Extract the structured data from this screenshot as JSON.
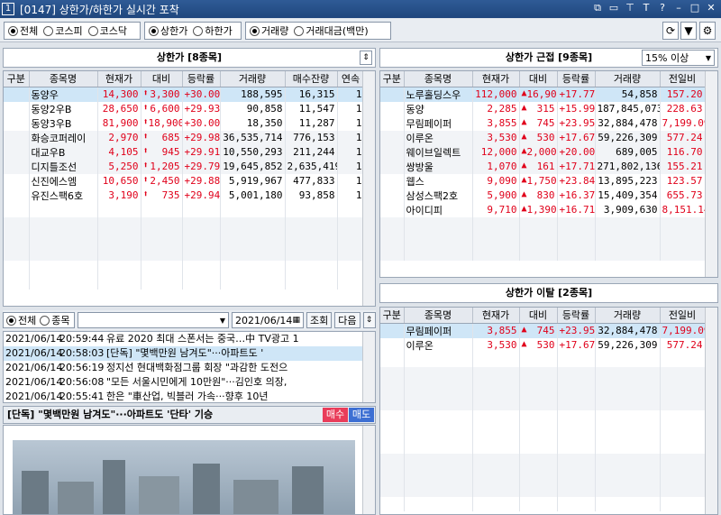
{
  "window": {
    "number": "1",
    "title": "[0147] 상한가/하한가 실시간 포착"
  },
  "filters": {
    "market": [
      "전체",
      "코스피",
      "코스닥"
    ],
    "limit_type": [
      "상한가",
      "하한가"
    ],
    "sort_by": [
      "거래량",
      "거래대금(백만)"
    ]
  },
  "upper": {
    "title": "상한가 [8종목]",
    "columns": [
      "구분",
      "종목명",
      "현재가",
      "대비",
      "등락률",
      "거래량",
      "매수잔량",
      "연속"
    ],
    "rows": [
      {
        "name": "동양우",
        "price": "14,300",
        "diff": "3,300",
        "rate": "+30.00",
        "vol": "188,595",
        "bid": "16,315",
        "cont": "1"
      },
      {
        "name": "동양2우B",
        "price": "28,650",
        "diff": "6,600",
        "rate": "+29.93",
        "vol": "90,858",
        "bid": "11,547",
        "cont": "1"
      },
      {
        "name": "동양3우B",
        "price": "81,900",
        "diff": "18,900",
        "rate": "+30.00",
        "vol": "18,350",
        "bid": "11,287",
        "cont": "1"
      },
      {
        "name": "화승코퍼레이",
        "price": "2,970",
        "diff": "685",
        "rate": "+29.98",
        "vol": "36,535,714",
        "bid": "776,153",
        "cont": "1"
      },
      {
        "name": "대교우B",
        "price": "4,105",
        "diff": "945",
        "rate": "+29.91",
        "vol": "10,550,293",
        "bid": "211,244",
        "cont": "1"
      },
      {
        "name": "디지틀조선",
        "price": "5,250",
        "diff": "1,205",
        "rate": "+29.79",
        "vol": "19,645,852",
        "bid": "2,635,419",
        "cont": "1"
      },
      {
        "name": "신진에스엠",
        "price": "10,650",
        "diff": "2,450",
        "rate": "+29.88",
        "vol": "5,919,967",
        "bid": "477,833",
        "cont": "1"
      },
      {
        "name": "유진스팩6호",
        "price": "3,190",
        "diff": "735",
        "rate": "+29.94",
        "vol": "5,001,180",
        "bid": "93,858",
        "cont": "1"
      }
    ]
  },
  "near": {
    "title": "상한가 근접 [9종목]",
    "threshold": "15% 이상",
    "columns": [
      "구분",
      "종목명",
      "현재가",
      "대비",
      "등락률",
      "거래량",
      "전일비"
    ],
    "rows": [
      {
        "name": "노루홀딩스우",
        "price": "112,000",
        "diff": "16,900",
        "rate": "+17.77",
        "vol": "54,858",
        "prev": "157.20"
      },
      {
        "name": "동양",
        "price": "2,285",
        "diff": "315",
        "rate": "+15.99",
        "vol": "187,845,073",
        "prev": "228.63"
      },
      {
        "name": "무림페이퍼",
        "price": "3,855",
        "diff": "745",
        "rate": "+23.95",
        "vol": "32,884,478",
        "prev": "7,199.09"
      },
      {
        "name": "이루온",
        "price": "3,530",
        "diff": "530",
        "rate": "+17.67",
        "vol": "59,226,309",
        "prev": "577.24"
      },
      {
        "name": "웨이브일렉트",
        "price": "12,000",
        "diff": "2,000",
        "rate": "+20.00",
        "vol": "689,005",
        "prev": "116.70"
      },
      {
        "name": "쌍방울",
        "price": "1,070",
        "diff": "161",
        "rate": "+17.71",
        "vol": "271,802,136",
        "prev": "155.21"
      },
      {
        "name": "웹스",
        "price": "9,090",
        "diff": "1,750",
        "rate": "+23.84",
        "vol": "13,895,223",
        "prev": "123.57"
      },
      {
        "name": "삼성스팩2호",
        "price": "5,900",
        "diff": "830",
        "rate": "+16.37",
        "vol": "15,409,354",
        "prev": "655.73"
      },
      {
        "name": "아이디피",
        "price": "9,710",
        "diff": "1,390",
        "rate": "+16.71",
        "vol": "3,909,630",
        "prev": "8,151.14"
      }
    ]
  },
  "leave": {
    "title": "상한가 이탈 [2종목]",
    "columns": [
      "구분",
      "종목명",
      "현재가",
      "대비",
      "등락률",
      "거래량",
      "전일비"
    ],
    "rows": [
      {
        "name": "무림페이퍼",
        "price": "3,855",
        "diff": "745",
        "rate": "+23.95",
        "vol": "32,884,478",
        "prev": "7,199.09"
      },
      {
        "name": "이루온",
        "price": "3,530",
        "diff": "530",
        "rate": "+17.67",
        "vol": "59,226,309",
        "prev": "577.24"
      }
    ]
  },
  "news": {
    "filter": [
      "전체",
      "종목"
    ],
    "date": "2021/06/14",
    "search_btn": "조회",
    "next_btn": "다음",
    "rows": [
      {
        "date": "2021/06/14",
        "time": "20:59:44",
        "text": "유료 2020 최대 스폰서는 중국…中 TV광고 1"
      },
      {
        "date": "2021/06/14",
        "time": "20:58:03",
        "text": "[단독] \"몇백만원 남겨도\"···아파트도 '"
      },
      {
        "date": "2021/06/14",
        "time": "20:56:19",
        "text": "정지선 현대백화점그룹 회장 \"과감한 도전으"
      },
      {
        "date": "2021/06/14",
        "time": "20:56:08",
        "text": "\"모든 서울시민에게 10만원\"···김인호 의장,"
      },
      {
        "date": "2021/06/14",
        "time": "20:55:41",
        "text": "한은 \"車산업, 빅블러 가속···향후 10년"
      }
    ],
    "headline": "[단독] \"몇백만원 남겨도\"···아파트도 '단타' 기승",
    "buy": "매수",
    "sell": "매도"
  }
}
